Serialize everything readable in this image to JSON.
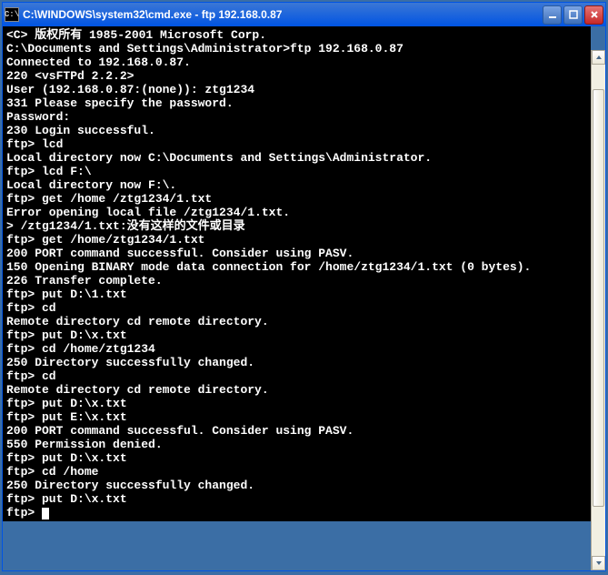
{
  "window": {
    "icon_label": "C:\\",
    "title": "C:\\WINDOWS\\system32\\cmd.exe - ftp 192.168.0.87"
  },
  "terminal": {
    "lines": [
      "<C> 版权所有 1985-2001 Microsoft Corp.",
      "",
      "C:\\Documents and Settings\\Administrator>ftp 192.168.0.87",
      "Connected to 192.168.0.87.",
      "220 <vsFTPd 2.2.2>",
      "User (192.168.0.87:(none)): ztg1234",
      "331 Please specify the password.",
      "Password:",
      "230 Login successful.",
      "ftp> lcd",
      "Local directory now C:\\Documents and Settings\\Administrator.",
      "ftp> lcd F:\\",
      "Local directory now F:\\.",
      "ftp> get /home /ztg1234/1.txt",
      "Error opening local file /ztg1234/1.txt.",
      "> /ztg1234/1.txt:没有这样的文件或目录",
      "ftp> get /home/ztg1234/1.txt",
      "200 PORT command successful. Consider using PASV.",
      "150 Opening BINARY mode data connection for /home/ztg1234/1.txt (0 bytes).",
      "226 Transfer complete.",
      "ftp> put D:\\1.txt",
      "ftp> cd",
      "Remote directory cd remote directory.",
      "ftp> put D:\\x.txt",
      "ftp> cd /home/ztg1234",
      "250 Directory successfully changed.",
      "ftp> cd",
      "Remote directory cd remote directory.",
      "ftp> put D:\\x.txt",
      "ftp> put E:\\x.txt",
      "200 PORT command successful. Consider using PASV.",
      "550 Permission denied.",
      "ftp> put D:\\x.txt",
      "ftp> cd /home",
      "250 Directory successfully changed.",
      "ftp> put D:\\x.txt",
      "ftp> "
    ]
  },
  "scrollbar": {
    "thumb_top_pct": 5,
    "thumb_height_pct": 85
  }
}
